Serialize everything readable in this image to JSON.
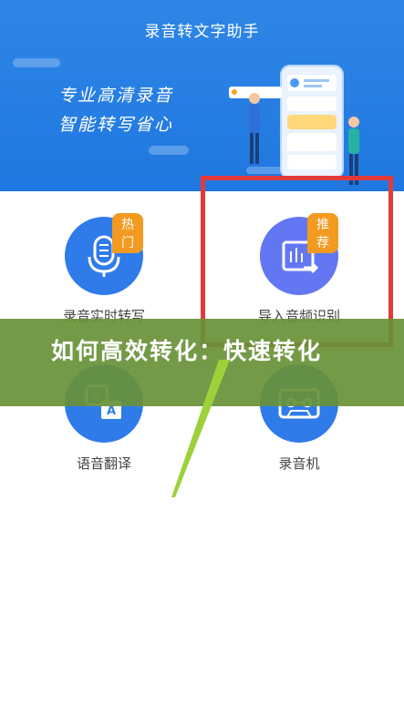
{
  "header": {
    "title": "录音转文字助手"
  },
  "banner": {
    "slogan_line1": "专业高清录音",
    "slogan_line2": "智能转写省心"
  },
  "features": {
    "realtime": {
      "label": "录音实时转写",
      "badge": "热门",
      "icon": "microphone-icon"
    },
    "import": {
      "label": "导入音频识别",
      "badge": "推荐",
      "icon": "import-audio-icon"
    },
    "translate": {
      "label": "语音翻译",
      "icon": "translate-icon"
    },
    "recorder": {
      "label": "录音机",
      "icon": "cassette-icon"
    }
  },
  "caption": {
    "text": "如何高效转化：快速转化"
  },
  "colors": {
    "banner": "#1f78e0",
    "circle_blue": "#2f7bea",
    "circle_purple": "#6477f2",
    "highlight": "#e23a3a",
    "band": "#68913b"
  }
}
